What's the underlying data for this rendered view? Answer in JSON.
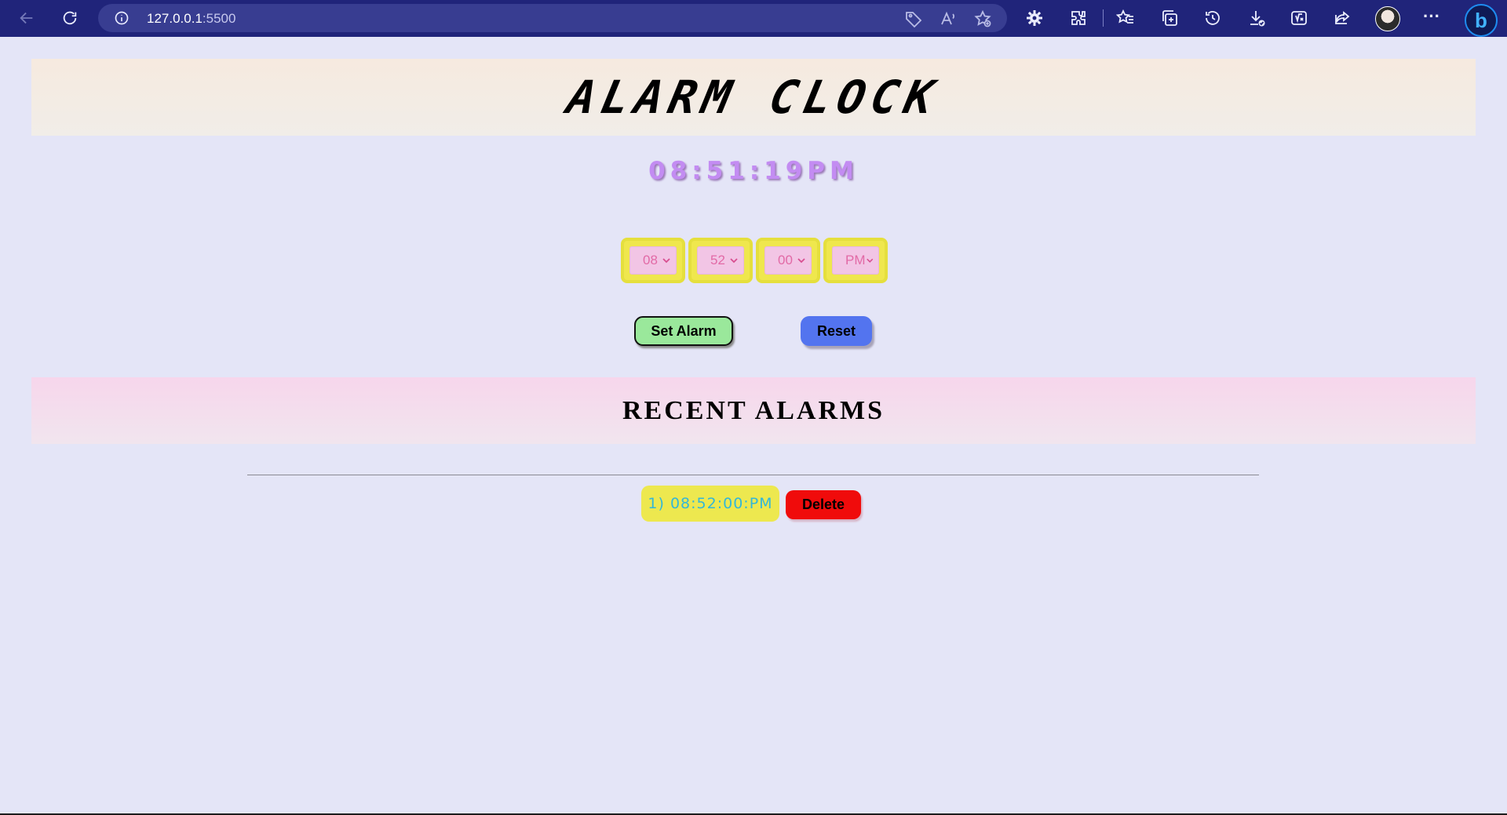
{
  "browser": {
    "url_host": "127.0.0.1",
    "url_port": ":5500",
    "icons": [
      "back-icon",
      "refresh-icon",
      "info-icon",
      "tag-icon",
      "read-aloud-icon",
      "favorite-add-icon",
      "settings-icon",
      "extensions-icon",
      "favorites-icon",
      "collections-icon",
      "history-icon",
      "downloads-icon",
      "math-solver-icon",
      "share-icon",
      "profile-avatar",
      "more-icon",
      "bing-icon"
    ],
    "bing_letter": "b",
    "more_label": "···"
  },
  "page": {
    "title": "ALARM CLOCK",
    "current_time": "08:51:19PM",
    "selects": {
      "hour": "08",
      "minute": "52",
      "second": "00",
      "ampm": "PM"
    },
    "set_alarm_label": "Set Alarm",
    "reset_label": "Reset",
    "recent_title": "RECENT ALARMS",
    "alarms": [
      {
        "text": "1) 08:52:00:PM",
        "delete_label": "Delete"
      }
    ]
  },
  "colors": {
    "background": "#e4e5f7",
    "chrome": "#20247a",
    "clock_text": "#c38cf2",
    "select_frame": "#efe74d",
    "select_bg": "#f2c5e5",
    "set_button": "#9ae89b",
    "reset_button": "#5374ef",
    "delete_button": "#f00b0b",
    "alarm_text": "#33b7d9"
  }
}
